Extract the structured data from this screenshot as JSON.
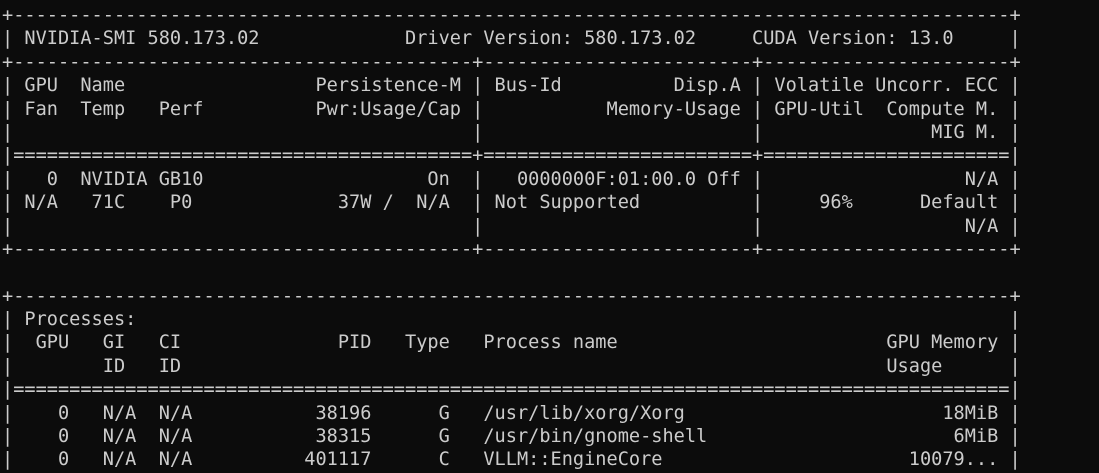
{
  "colors": {
    "background": "#0c0c0c",
    "text": "#cccccc"
  },
  "terminal": {
    "lines": [
      "+-----------------------------------------------------------------------------------------+",
      "| NVIDIA-SMI 580.173.02             Driver Version: 580.173.02     CUDA Version: 13.0     |",
      "+-----------------------------------------+------------------------+----------------------+",
      "| GPU  Name                 Persistence-M | Bus-Id          Disp.A | Volatile Uncorr. ECC |",
      "| Fan  Temp   Perf          Pwr:Usage/Cap |           Memory-Usage | GPU-Util  Compute M. |",
      "|                                         |                        |               MIG M. |",
      "|=========================================+========================+======================|",
      "|   0  NVIDIA GB10                    On  |   0000000F:01:00.0 Off |                  N/A |",
      "| N/A   71C    P0             37W /  N/A  | Not Supported          |     96%      Default |",
      "|                                         |                        |                  N/A |",
      "+-----------------------------------------+------------------------+----------------------+",
      "",
      "+-----------------------------------------------------------------------------------------+",
      "| Processes:                                                                              |",
      "|  GPU   GI   CI              PID   Type   Process name                        GPU Memory |",
      "|        ID   ID                                                               Usage      |",
      "|=========================================================================================|",
      "|    0   N/A  N/A           38196      G   /usr/lib/xorg/Xorg                       18MiB |",
      "|    0   N/A  N/A           38315      G   /usr/bin/gnome-shell                      6MiB |",
      "|    0   N/A  N/A          401117      C   VLLM::EngineCore                      10079... |",
      "+-----------------------------------------------------------------------------------------+"
    ]
  }
}
